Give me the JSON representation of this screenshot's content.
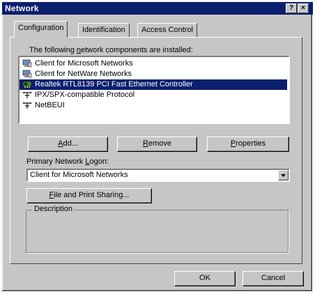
{
  "window": {
    "title": "Network",
    "help_button": "?",
    "close_button": "×"
  },
  "tabs": [
    {
      "label": "Configuration",
      "active": true
    },
    {
      "label": "Identification",
      "active": false
    },
    {
      "label": "Access Control",
      "active": false
    }
  ],
  "components": {
    "heading_prefix": "The following ",
    "heading_accel": "n",
    "heading_suffix": "etwork components are installed:",
    "items": [
      {
        "label": "Client for Microsoft Networks",
        "icon": "client-icon",
        "selected": false
      },
      {
        "label": "Client for NetWare Networks",
        "icon": "client-icon",
        "selected": false
      },
      {
        "label": "Realtek RTL8139 PCI Fast Ethernet Controller",
        "icon": "network-adapter-icon",
        "selected": true
      },
      {
        "label": "IPX/SPX-compatible Protocol",
        "icon": "protocol-icon",
        "selected": false
      },
      {
        "label": "NetBEUI",
        "icon": "protocol-icon",
        "selected": false
      }
    ]
  },
  "buttons": {
    "add": {
      "accel": "A",
      "rest": "dd..."
    },
    "remove": {
      "accel": "R",
      "rest": "emove"
    },
    "properties": {
      "accel": "P",
      "rest": "roperties"
    },
    "file_print": {
      "accel": "F",
      "rest": "ile and Print Sharing..."
    },
    "ok": "OK",
    "cancel": "Cancel"
  },
  "logon": {
    "label_prefix": "Primary Network ",
    "label_accel": "L",
    "label_suffix": "ogon:",
    "selected": "Client for Microsoft Networks"
  },
  "description": {
    "title": "Description"
  },
  "colors": {
    "face": "#c6c6c6",
    "selection": "#0a1f6e",
    "titlebar": "#0a1f6e"
  }
}
